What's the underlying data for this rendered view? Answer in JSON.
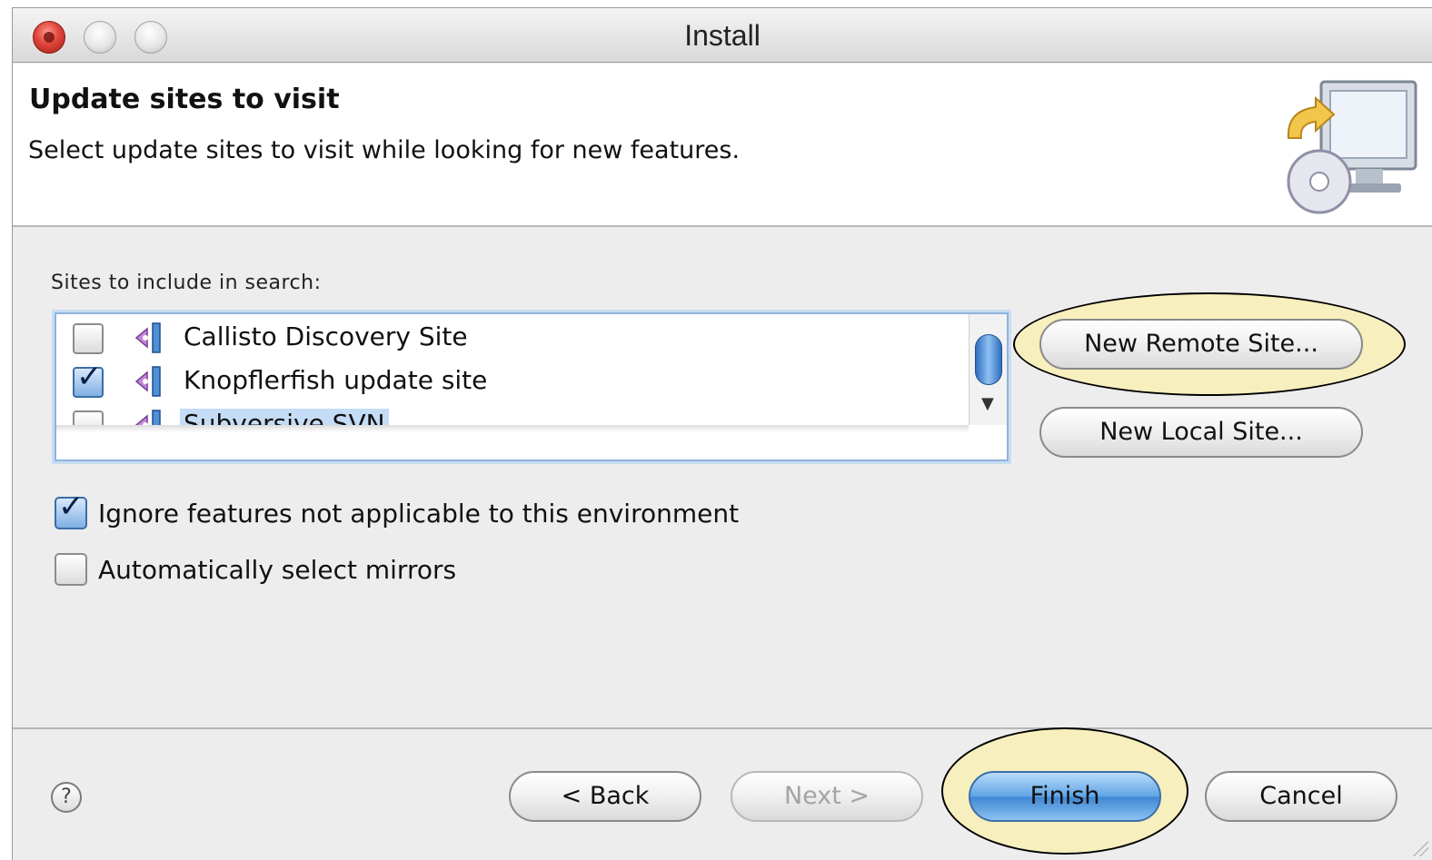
{
  "window": {
    "title": "Install"
  },
  "header": {
    "title": "Update sites to visit",
    "description": "Select update sites to visit while looking for new features."
  },
  "sites": {
    "label": "Sites to include in search:",
    "items": [
      {
        "name": "Callisto Discovery Site",
        "checked": false
      },
      {
        "name": "Knopflerfish update site",
        "checked": true
      },
      {
        "name": "Subversive SVN",
        "checked": false,
        "selected": true
      }
    ]
  },
  "side_buttons": {
    "new_remote": "New Remote Site...",
    "new_local": "New Local Site..."
  },
  "options": {
    "ignore_features": {
      "label": "Ignore features not applicable to this environment",
      "checked": true
    },
    "auto_mirrors": {
      "label": "Automatically select mirrors",
      "checked": false
    }
  },
  "footer": {
    "help": "?",
    "back": "< Back",
    "next": "Next >",
    "finish": "Finish",
    "cancel": "Cancel"
  },
  "colors": {
    "highlight": "#f8eeb4",
    "selection": "#c5dcf6",
    "focus_ring": "#8fb3dd"
  }
}
